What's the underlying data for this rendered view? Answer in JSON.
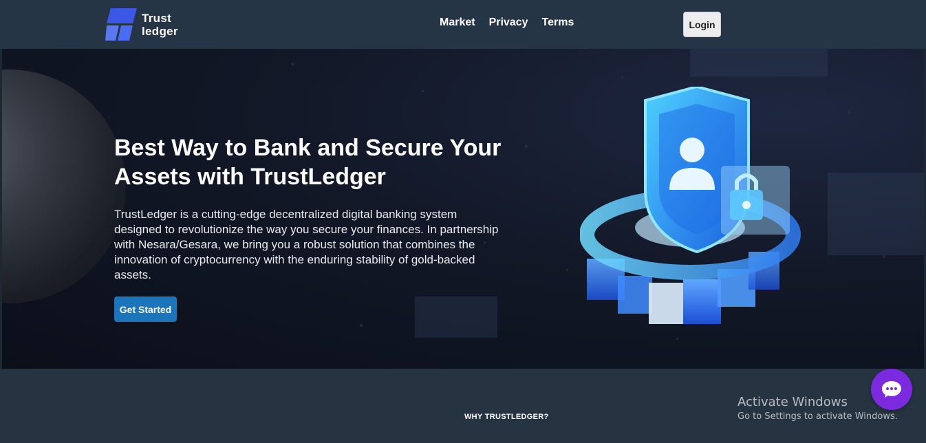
{
  "header": {
    "logo_line1": "Trust",
    "logo_line2": "ledger",
    "nav": [
      "Market",
      "Privacy",
      "Terms"
    ],
    "login_label": "Login"
  },
  "hero": {
    "title_line1": "Best Way to Bank and Secure Your",
    "title_line2": "Assets with TrustLedger",
    "description": "TrustLedger is a cutting-edge decentralized digital banking system designed to revolutionize the way you secure your finances. In partnership with Nesara/Gesara, we bring you a robust solution that combines the innovation of cryptocurrency with the enduring stability of gold-backed assets.",
    "cta_label": "Get Started"
  },
  "section": {
    "why_heading": "WHY TRUSTLEDGER?"
  },
  "watermark": {
    "line1": "Activate Windows",
    "line2": "Go to Settings to activate Windows."
  },
  "icons": {
    "logo": "logo-mark-icon",
    "illustration": "shield-user-lock-icon",
    "chat": "chat-bubble-icon"
  },
  "colors": {
    "header_bg": "#253545",
    "accent": "#1b75bb",
    "chat_button": "#7b2ae0"
  }
}
